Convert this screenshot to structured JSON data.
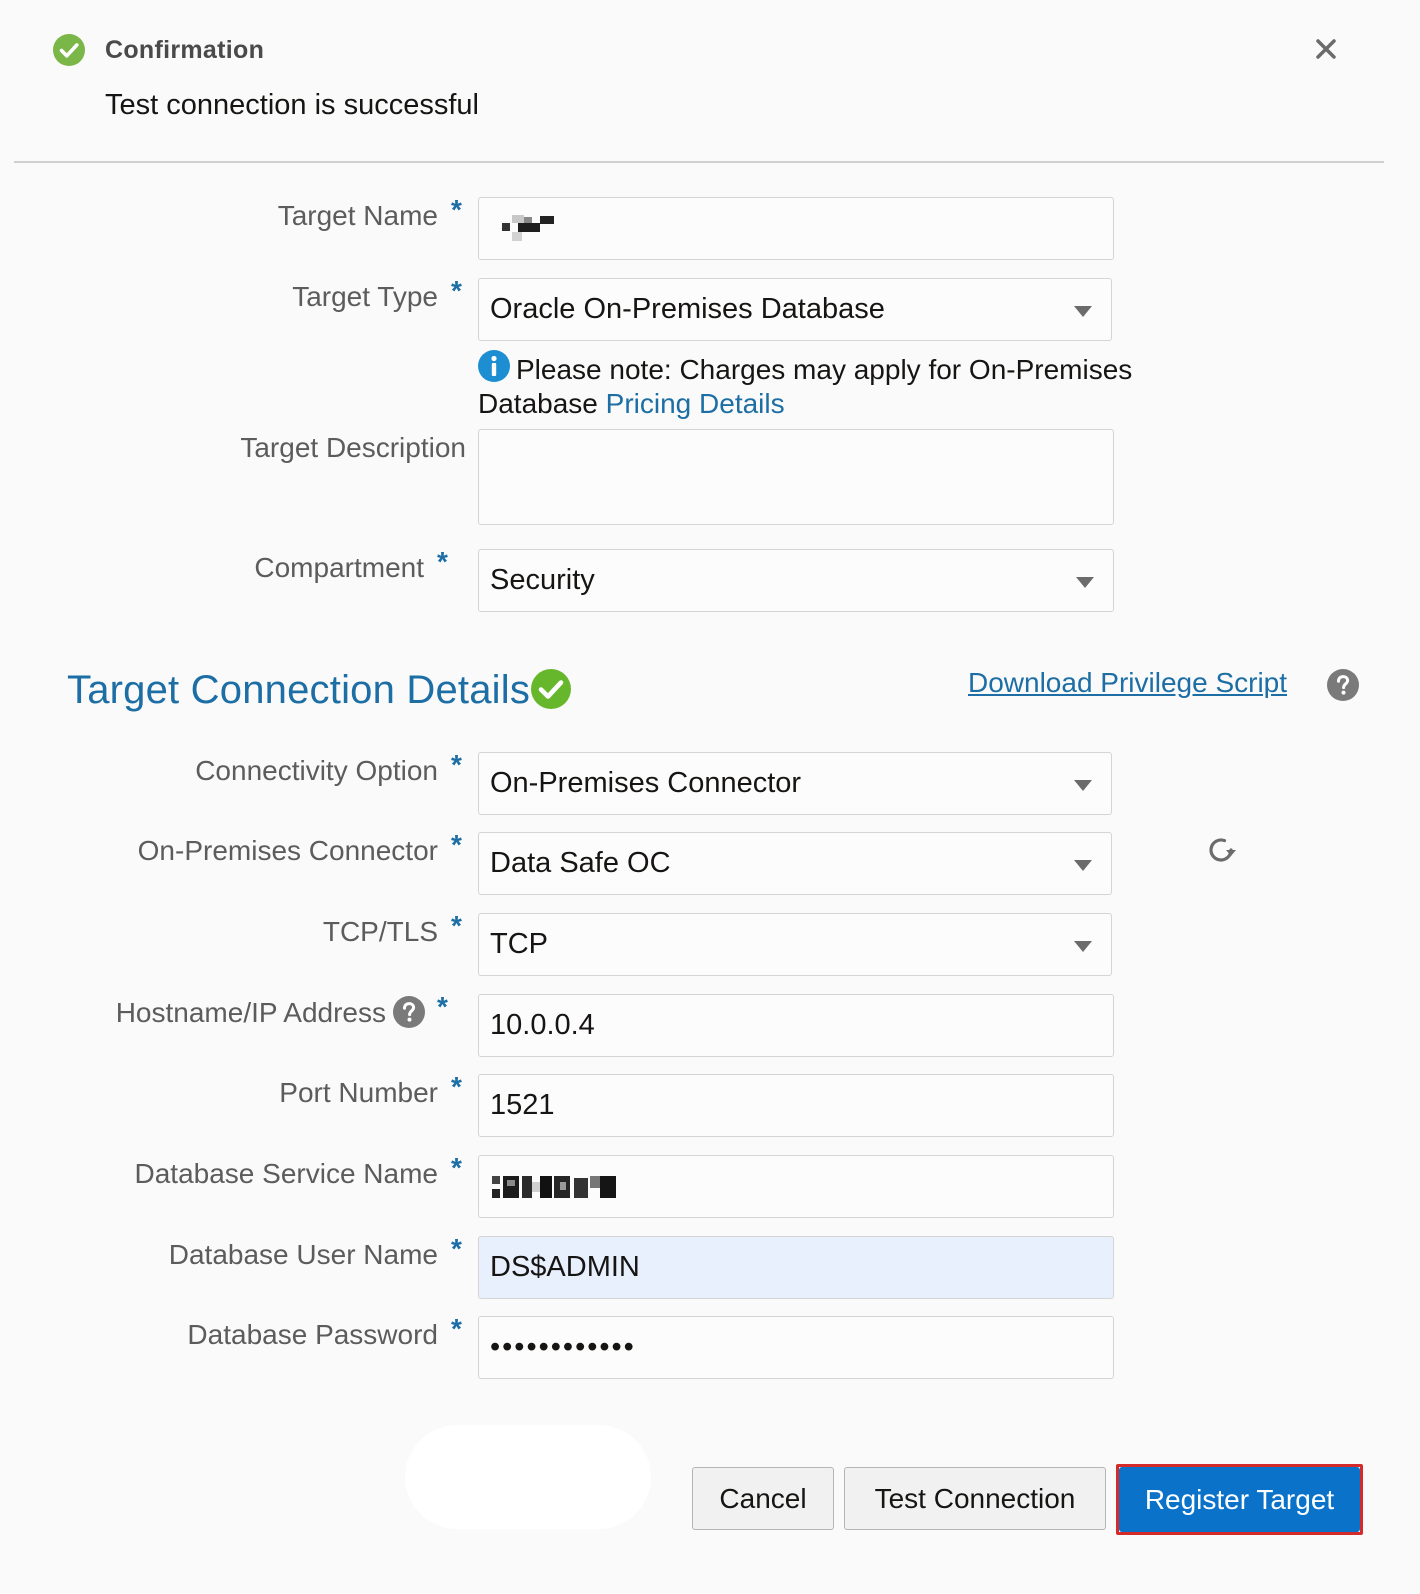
{
  "confirmation": {
    "title": "Confirmation",
    "message": "Test connection is successful",
    "success_color": "#7ab648"
  },
  "form": {
    "required_mark": "*",
    "target_name": {
      "label": "Target Name",
      "value_redacted": true
    },
    "target_type": {
      "label": "Target Type",
      "value": "Oracle On-Premises Database"
    },
    "note": {
      "text": "Please note: Charges may apply for On-Premises Database",
      "link": "Pricing Details"
    },
    "target_description": {
      "label": "Target Description",
      "value": ""
    },
    "compartment": {
      "label": "Compartment",
      "value": "Security"
    }
  },
  "connection": {
    "title": "Target Connection Details",
    "download_link": "Download Privilege Script",
    "connectivity_option": {
      "label": "Connectivity Option",
      "value": "On-Premises Connector"
    },
    "connector": {
      "label": "On-Premises Connector",
      "value": "Data Safe OC"
    },
    "tcp_tls": {
      "label": "TCP/TLS",
      "value": "TCP"
    },
    "hostname": {
      "label": "Hostname/IP Address",
      "value": "10.0.0.4"
    },
    "port": {
      "label": "Port Number",
      "value": "1521"
    },
    "service_name": {
      "label": "Database Service Name",
      "value_redacted": true
    },
    "user_name": {
      "label": "Database User Name",
      "value": "DS$ADMIN"
    },
    "password": {
      "label": "Database Password",
      "value": "••••••••••••"
    }
  },
  "buttons": {
    "cancel": "Cancel",
    "test_connection": "Test Connection",
    "register_target": "Register Target"
  },
  "colors": {
    "accent": "#1c6ea4",
    "primary_button": "#0a73c9",
    "highlight_border": "#d42a2a",
    "autofill": "#e8f0fe"
  }
}
